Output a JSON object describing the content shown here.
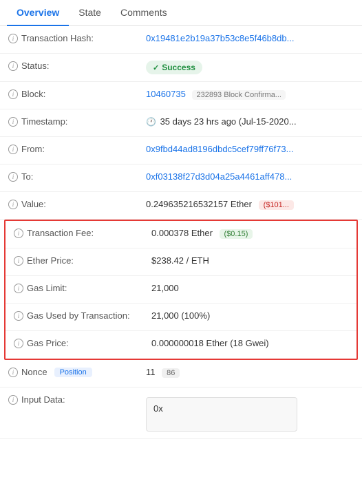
{
  "tabs": [
    {
      "id": "overview",
      "label": "Overview",
      "active": true
    },
    {
      "id": "state",
      "label": "State",
      "active": false
    },
    {
      "id": "comments",
      "label": "Comments",
      "active": false
    }
  ],
  "rows": {
    "transaction_hash": {
      "label": "Transaction Hash:",
      "value": "0x19481e2b19a37b53c8e5f46b8db..."
    },
    "status": {
      "label": "Status:",
      "value": "Success"
    },
    "block": {
      "label": "Block:",
      "block_num": "10460735",
      "confirmations": "232893 Block Confirma..."
    },
    "timestamp": {
      "label": "Timestamp:",
      "value": "35 days 23 hrs ago (Jul-15-2020..."
    },
    "from": {
      "label": "From:",
      "value": "0x9fbd44ad8196dbdc5cef79ff76f73..."
    },
    "to": {
      "label": "To:",
      "value": "0xf03138f27d3d04a25a4461aff478..."
    },
    "value": {
      "label": "Value:",
      "ether": "0.249635216532157 Ether",
      "usd": "($101..."
    },
    "transaction_fee": {
      "label": "Transaction Fee:",
      "ether": "0.000378 Ether",
      "usd": "($0.15)"
    },
    "ether_price": {
      "label": "Ether Price:",
      "value": "$238.42 / ETH"
    },
    "gas_limit": {
      "label": "Gas Limit:",
      "value": "21,000"
    },
    "gas_used": {
      "label": "Gas Used by Transaction:",
      "value": "21,000 (100%)"
    },
    "gas_price": {
      "label": "Gas Price:",
      "value": "0.000000018 Ether (18 Gwei)"
    },
    "nonce": {
      "label": "Nonce",
      "badge": "Position",
      "value": "11",
      "position": "86"
    },
    "input_data": {
      "label": "Input Data:",
      "value": "0x"
    }
  },
  "icons": {
    "help": "i",
    "check": "✓",
    "clock": "🕐"
  },
  "colors": {
    "active_tab": "#1a73e8",
    "link": "#1a73e8",
    "success_bg": "#e6f4ea",
    "success_text": "#1e8e3e",
    "highlight_border": "#e53935",
    "usd_red_bg": "#fce8e6",
    "usd_red_text": "#c5221f"
  }
}
